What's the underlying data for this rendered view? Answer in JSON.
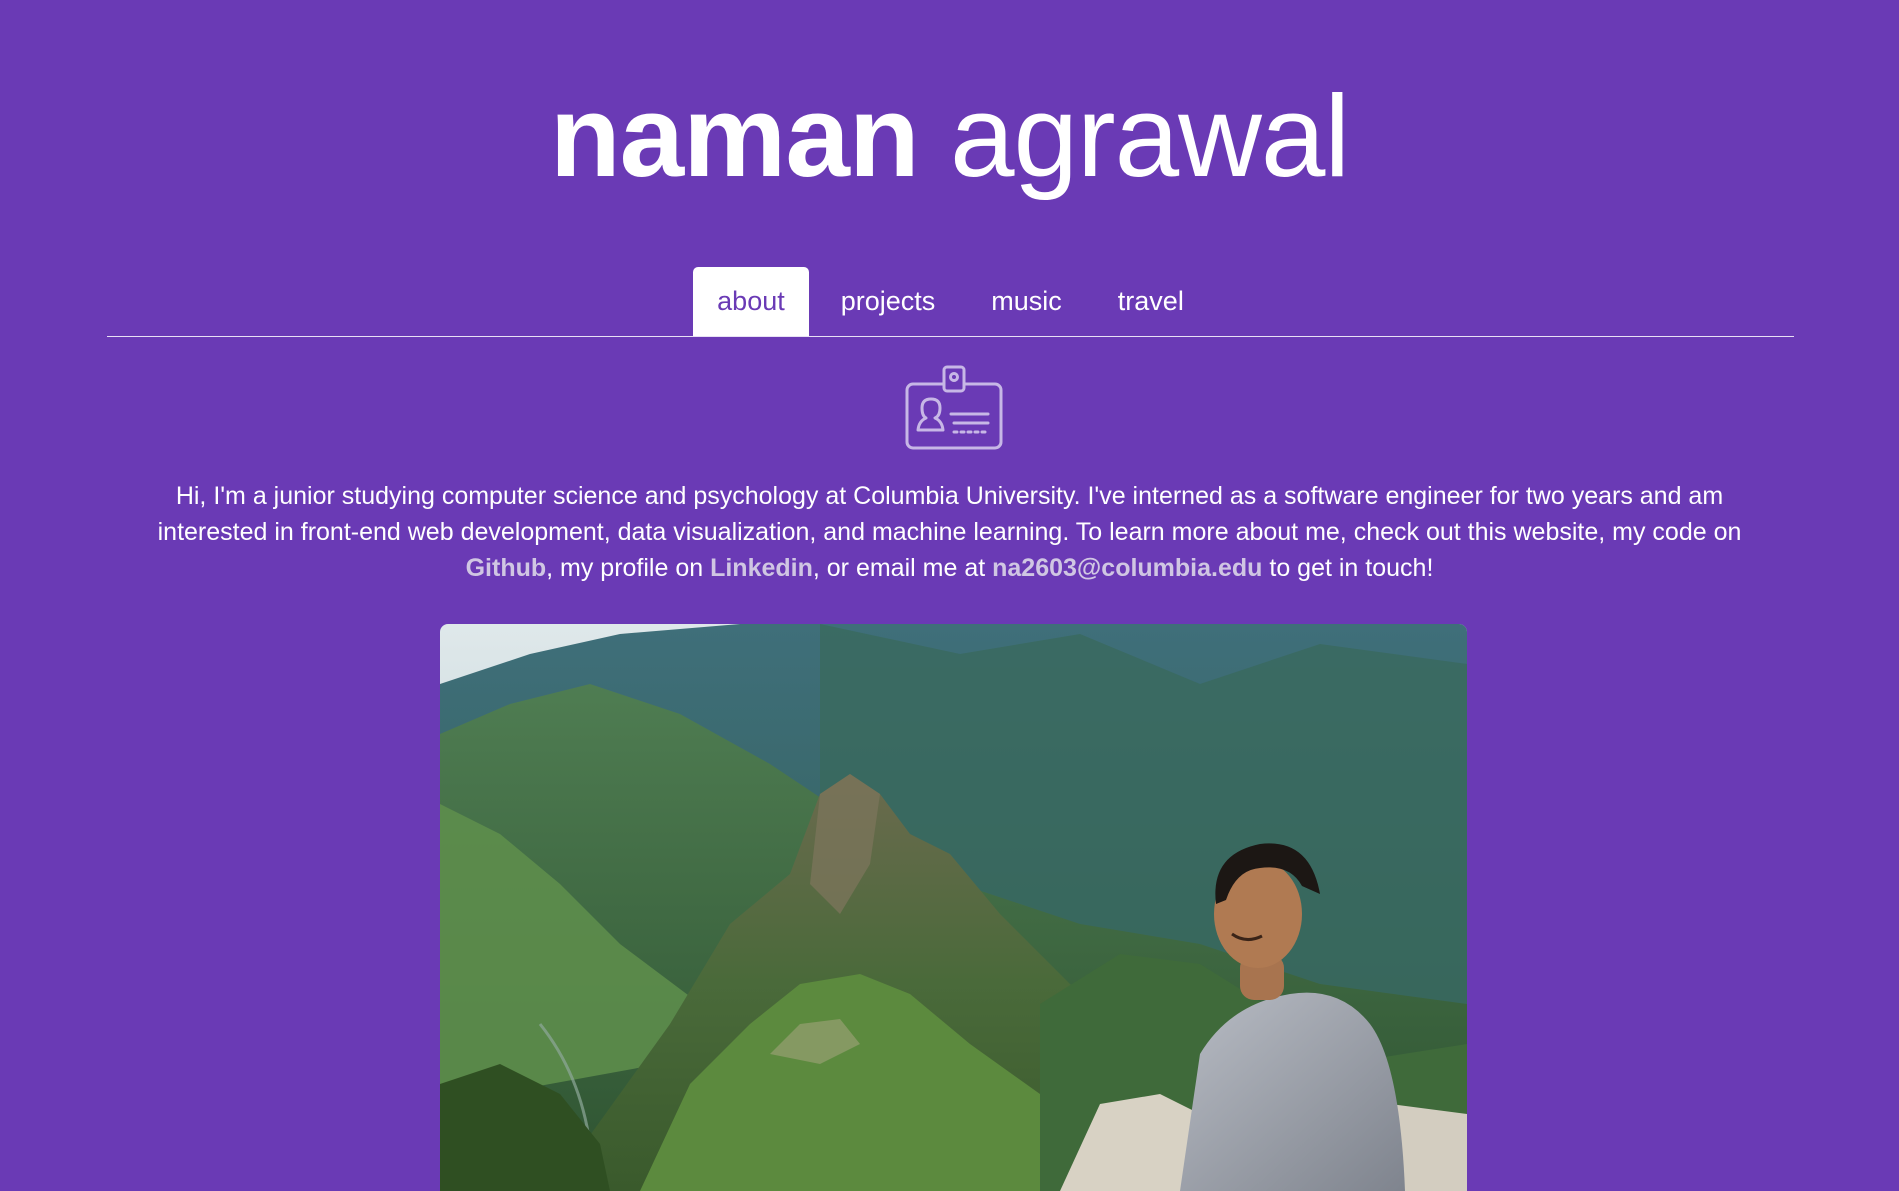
{
  "header": {
    "first_name": "naman",
    "last_name": "agrawal"
  },
  "nav": {
    "tabs": [
      {
        "label": "about",
        "active": true
      },
      {
        "label": "projects",
        "active": false
      },
      {
        "label": "music",
        "active": false
      },
      {
        "label": "travel",
        "active": false
      }
    ]
  },
  "about": {
    "icon": "id-badge-icon",
    "intro_part1": "Hi, I'm a junior studying computer science and psychology at Columbia University. I've interned as a software engineer for two years and am interested in front-end web development, data visualization, and machine learning. To learn more about me, check out this website, my code on ",
    "github_label": "Github",
    "intro_part2": ", my profile on ",
    "linkedin_label": "Linkedin",
    "intro_part3": ", or email me at ",
    "email_label": "na2603@columbia.edu",
    "intro_part4": " to get in touch!"
  },
  "colors": {
    "background": "#6a3ab5",
    "link": "#d0c6e3",
    "text": "#ffffff"
  }
}
